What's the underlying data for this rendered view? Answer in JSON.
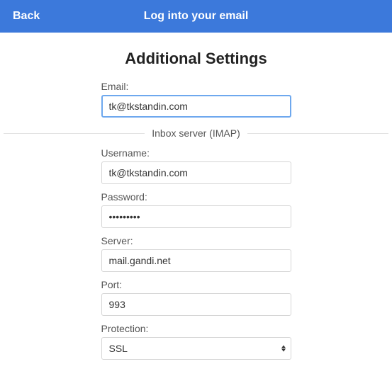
{
  "header": {
    "back_label": "Back",
    "title": "Log into your email"
  },
  "page_title": "Additional Settings",
  "email": {
    "label": "Email:",
    "value": "tk@tkstandin.com"
  },
  "section_inbox_title": "Inbox server (IMAP)",
  "inbox": {
    "username": {
      "label": "Username:",
      "value": "tk@tkstandin.com"
    },
    "password": {
      "label": "Password:",
      "value": "•••••••••"
    },
    "server": {
      "label": "Server:",
      "value": "mail.gandi.net"
    },
    "port": {
      "label": "Port:",
      "value": "993"
    },
    "protection": {
      "label": "Protection:",
      "value": "SSL"
    }
  }
}
